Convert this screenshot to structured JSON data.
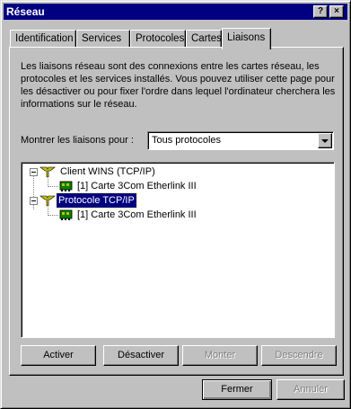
{
  "window": {
    "title": "Réseau",
    "help_label": "?",
    "close_label": "×"
  },
  "tabs": [
    {
      "label": "Identification"
    },
    {
      "label": "Services"
    },
    {
      "label": "Protocoles"
    },
    {
      "label": "Cartes"
    },
    {
      "label": "Liaisons"
    }
  ],
  "active_tab": "Liaisons",
  "description": "Les liaisons réseau sont des connexions entre les cartes réseau, les protocoles et les services installés.  Vous pouvez utiliser cette page pour les désactiver ou pour fixer l'ordre dans lequel l'ordinateur cherchera les informations sur le réseau.",
  "show_bindings": {
    "label": "Montrer les liaisons pour :",
    "selected": "Tous protocoles"
  },
  "tree": {
    "nodes": [
      {
        "label": "Client WINS (TCP/IP)",
        "level": 0,
        "expanded": true,
        "icon": "protocol-icon"
      },
      {
        "label": "[1] Carte 3Com Etherlink III",
        "level": 1,
        "icon": "network-card-icon"
      },
      {
        "label": "Protocole TCP/IP",
        "level": 0,
        "expanded": true,
        "selected": true,
        "icon": "protocol-icon"
      },
      {
        "label": "[1] Carte 3Com Etherlink III",
        "level": 1,
        "icon": "network-card-icon"
      }
    ]
  },
  "panel_buttons": {
    "enable": "Activer",
    "disable": "Désactiver",
    "up": "Monter",
    "down": "Descendre"
  },
  "dialog_buttons": {
    "close": "Fermer",
    "cancel": "Annuler"
  }
}
